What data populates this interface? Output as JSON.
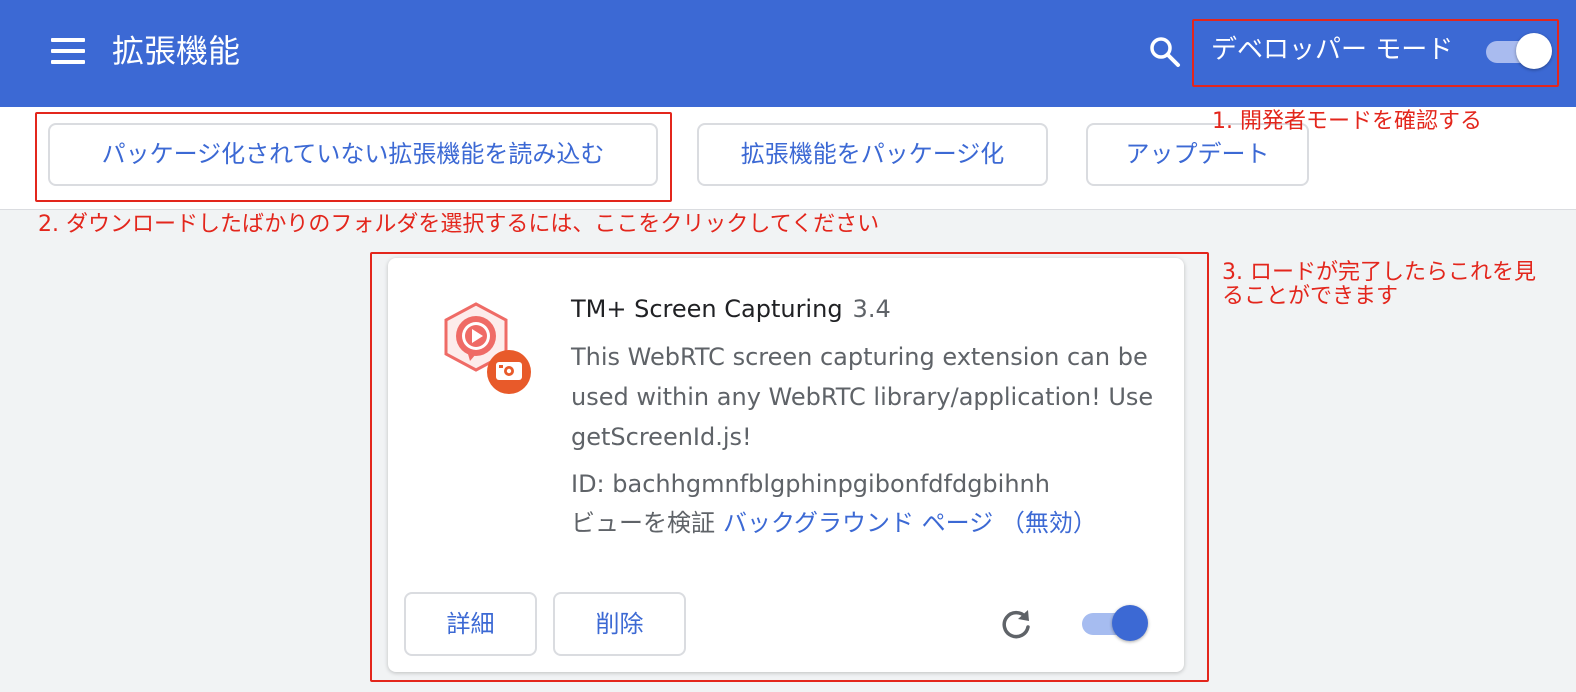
{
  "header": {
    "title": "拡張機能",
    "dev_mode_label": "デベロッパー モード",
    "dev_mode_enabled": true,
    "accent_color": "#3c69d4"
  },
  "toolbar": {
    "load_unpacked_label": "パッケージ化されていない拡張機能を読み込む",
    "pack_label": "拡張機能をパッケージ化",
    "update_label": "アップデート"
  },
  "extension": {
    "name": "TM+ Screen Capturing",
    "version": "3.4",
    "description": "This WebRTC screen capturing extension can be used within any WebRTC library/application! Use getScreenId.js!",
    "id_text": "ID: bachhgmnfblgphinpgibonfdfdgbihnh",
    "inspect_label": "ビューを検証",
    "inspect_link": "バックグラウンド ページ （無効）",
    "details_label": "詳細",
    "remove_label": "削除",
    "enabled": true,
    "icon": "screen-capture-icon"
  },
  "annotations": {
    "step1": "1. 開発者モードを確認する",
    "step2": "2. ダウンロードしたばかりのフォルダを選択するには、ここをクリックしてください",
    "step3_line1": "3. ロードが完了したらこれを見",
    "step3_line2": "ることができます",
    "color": "#e3261c"
  }
}
